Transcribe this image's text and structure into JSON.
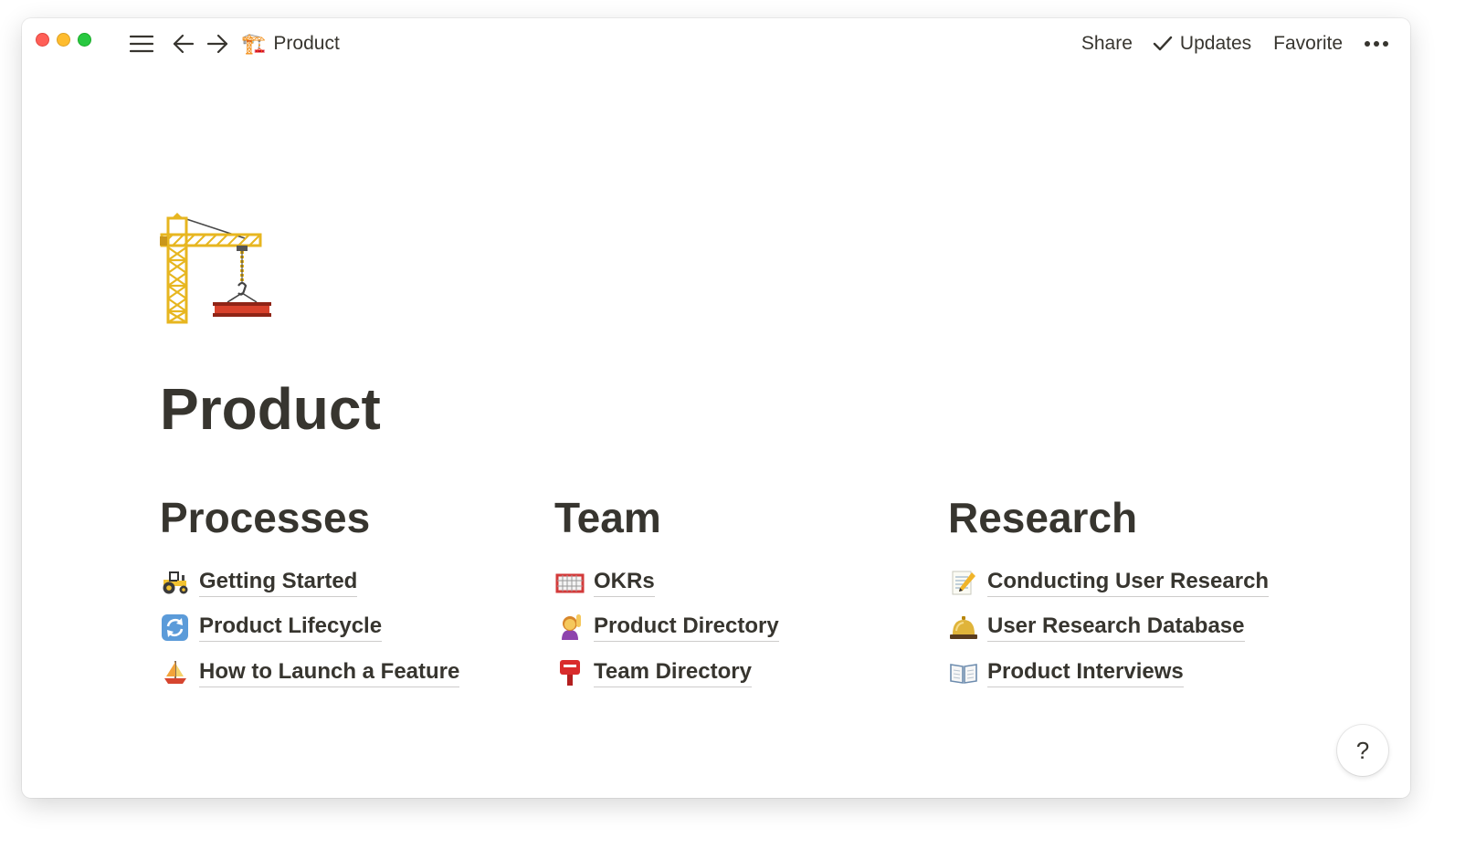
{
  "topbar": {
    "breadcrumb": {
      "emoji": "🏗️",
      "label": "Product"
    },
    "share_label": "Share",
    "updates_label": "Updates",
    "favorite_label": "Favorite",
    "icons": [
      "menu-icon",
      "back-arrow-icon",
      "forward-arrow-icon",
      "checkmark-icon",
      "more-icon"
    ]
  },
  "page": {
    "icon": "crane-icon",
    "title": "Product"
  },
  "columns": [
    {
      "heading": "Processes",
      "links": [
        {
          "emoji": "🚜",
          "icon": "tractor-icon",
          "label": "Getting Started"
        },
        {
          "emoji": "🔄",
          "icon": "cycle-arrows-icon",
          "label": "Product Lifecycle"
        },
        {
          "emoji": "⛵",
          "icon": "sailboat-icon",
          "label": "How to Launch a Feature"
        }
      ]
    },
    {
      "heading": "Team",
      "links": [
        {
          "emoji": "🥅",
          "icon": "goal-net-icon",
          "label": "OKRs"
        },
        {
          "emoji": "🙋‍♀️",
          "icon": "person-raising-hand-icon",
          "label": "Product Directory"
        },
        {
          "emoji": "📮",
          "icon": "postbox-icon",
          "label": "Team Directory"
        }
      ]
    },
    {
      "heading": "Research",
      "links": [
        {
          "emoji": "📝",
          "icon": "memo-icon",
          "label": "Conducting User Research"
        },
        {
          "emoji": "🛎️",
          "icon": "bellhop-bell-icon",
          "label": "User Research Database"
        },
        {
          "emoji": "📖",
          "icon": "open-book-icon",
          "label": "Product Interviews"
        }
      ]
    }
  ],
  "help_label": "?",
  "colors": {
    "text": "#37352f",
    "close": "#ff5f57",
    "minimize": "#febc2e",
    "maximize": "#28c840"
  }
}
